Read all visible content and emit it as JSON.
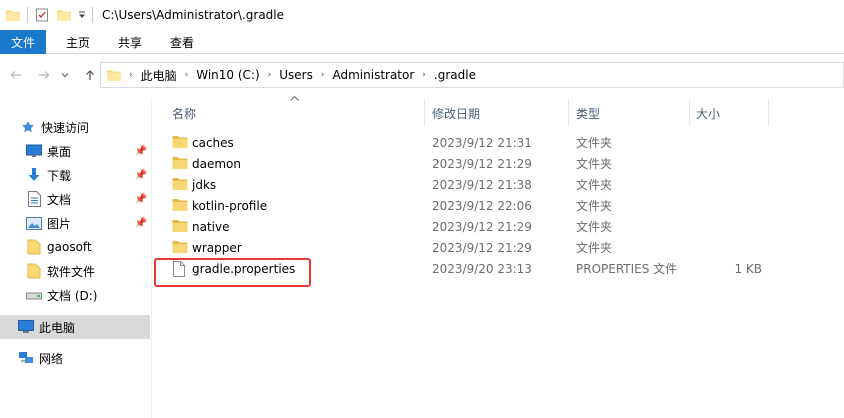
{
  "window": {
    "path_title": "C:\\Users\\Administrator\\.gradle"
  },
  "ribbon": {
    "tabs": [
      "文件",
      "主页",
      "共享",
      "查看"
    ]
  },
  "address": {
    "crumbs": [
      "此电脑",
      "Win10 (C:)",
      "Users",
      "Administrator",
      ".gradle"
    ]
  },
  "nav": {
    "quick_access": "快速访问",
    "desktop": "桌面",
    "downloads": "下载",
    "documents": "文档",
    "pictures": "图片",
    "gaosoft": "gaosoft",
    "software_files": "软件文件",
    "drive_d": "文档 (D:)",
    "this_pc": "此电脑",
    "network": "网络"
  },
  "columns": {
    "name": "名称",
    "modified": "修改日期",
    "type": "类型",
    "size": "大小"
  },
  "files": [
    {
      "name": "caches",
      "modified": "2023/9/12 21:31",
      "type": "文件夹",
      "size": "",
      "icon": "folder-icon"
    },
    {
      "name": "daemon",
      "modified": "2023/9/12 21:29",
      "type": "文件夹",
      "size": "",
      "icon": "folder-icon"
    },
    {
      "name": "jdks",
      "modified": "2023/9/12 21:38",
      "type": "文件夹",
      "size": "",
      "icon": "folder-icon"
    },
    {
      "name": "kotlin-profile",
      "modified": "2023/9/12 22:06",
      "type": "文件夹",
      "size": "",
      "icon": "folder-icon"
    },
    {
      "name": "native",
      "modified": "2023/9/12 21:29",
      "type": "文件夹",
      "size": "",
      "icon": "folder-icon"
    },
    {
      "name": "wrapper",
      "modified": "2023/9/12 21:29",
      "type": "文件夹",
      "size": "",
      "icon": "folder-icon"
    },
    {
      "name": "gradle.properties",
      "modified": "2023/9/20 23:13",
      "type": "PROPERTIES 文件",
      "size": "1 KB",
      "icon": "file-icon"
    }
  ],
  "colors": {
    "file_tab": "#1979ca",
    "folder": "#f8d775",
    "highlight": "#e53935",
    "header_text": "#4c607a"
  }
}
